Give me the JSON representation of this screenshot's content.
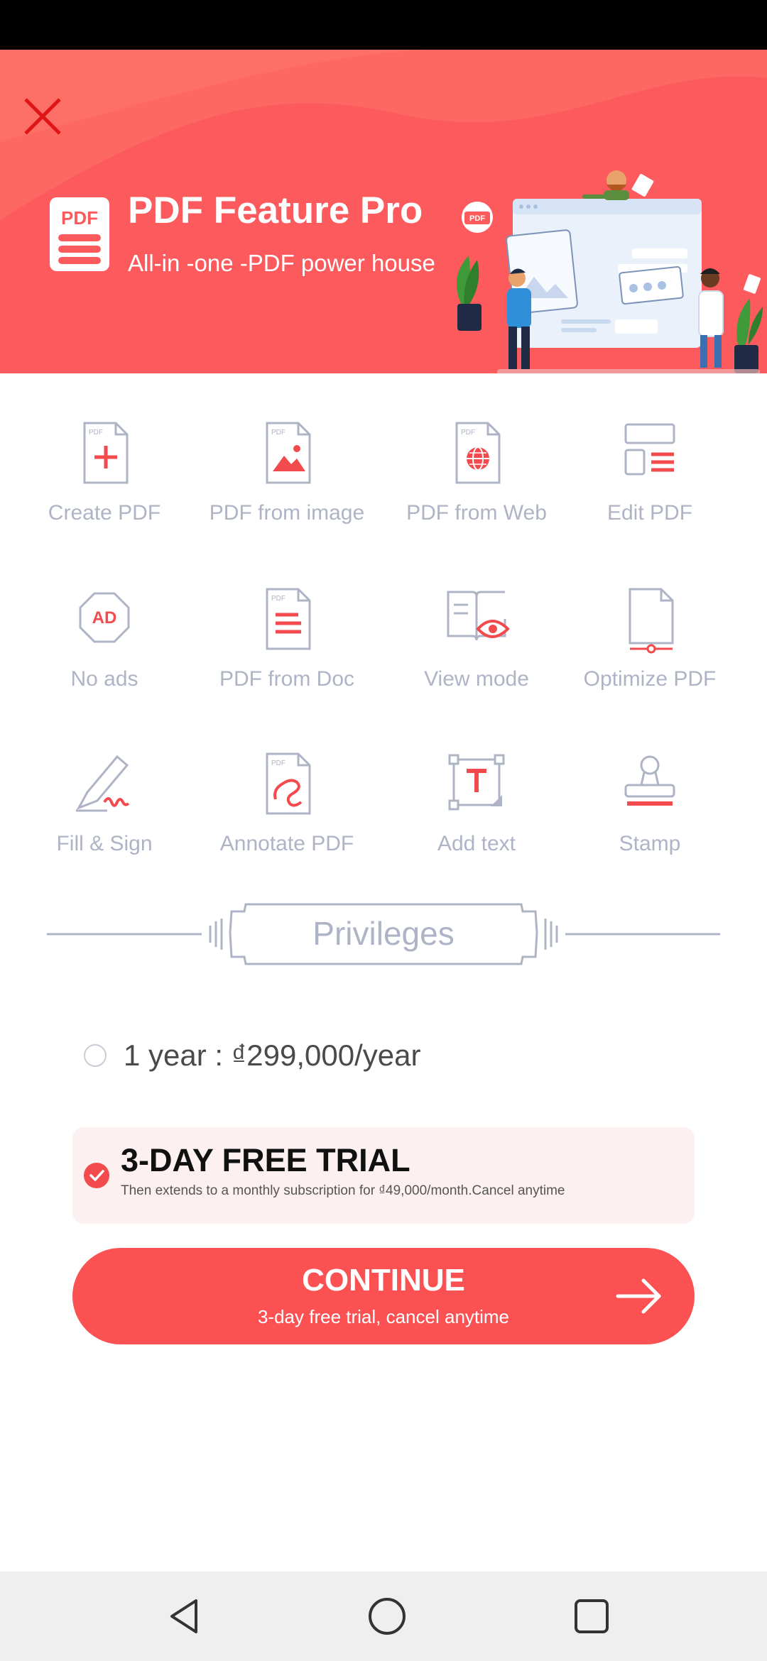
{
  "header": {
    "title": "PDF Feature Pro",
    "subtitle": "All-in -one -PDF power house",
    "logo_text": "PDF"
  },
  "colors": {
    "brand": "#fc5a5c",
    "accent": "#fc5153",
    "icon_gray": "#aeb4c6",
    "trial_bg": "#fdf0f0"
  },
  "features": [
    {
      "label": "Create PDF",
      "icon": "create-pdf-icon"
    },
    {
      "label": "PDF from image",
      "icon": "pdf-from-image-icon"
    },
    {
      "label": "PDF from Web",
      "icon": "pdf-from-web-icon"
    },
    {
      "label": "Edit PDF",
      "icon": "edit-pdf-icon"
    },
    {
      "label": "No ads",
      "icon": "no-ads-icon"
    },
    {
      "label": "PDF from Doc",
      "icon": "pdf-from-doc-icon"
    },
    {
      "label": "View mode",
      "icon": "view-mode-icon"
    },
    {
      "label": "Optimize PDF",
      "icon": "optimize-pdf-icon"
    },
    {
      "label": "Fill & Sign",
      "icon": "fill-sign-icon"
    },
    {
      "label": "Annotate PDF",
      "icon": "annotate-pdf-icon"
    },
    {
      "label": "Add text",
      "icon": "add-text-icon"
    },
    {
      "label": "Stamp",
      "icon": "stamp-icon"
    }
  ],
  "privileges": {
    "label": "Privileges"
  },
  "plans": {
    "yearly": {
      "label": "1 year : ₫299,000/year",
      "selected": false
    },
    "trial": {
      "title": "3-DAY FREE TRIAL",
      "description": "Then extends to a monthly subscription for ₫49,000/month.Cancel anytime",
      "selected": true
    }
  },
  "cta": {
    "label": "CONTINUE",
    "sublabel": "3-day free trial, cancel anytime"
  },
  "navbar": {
    "buttons": [
      "back-icon",
      "home-icon",
      "recents-icon"
    ]
  }
}
